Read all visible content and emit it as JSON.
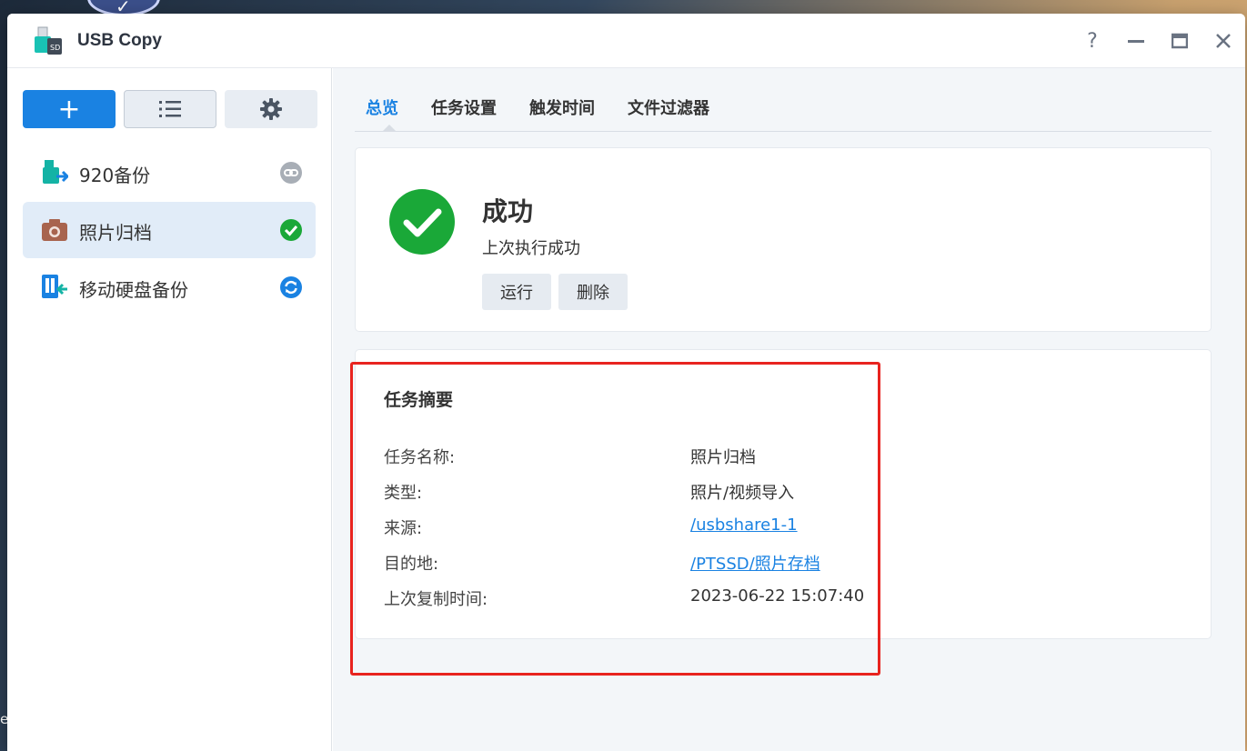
{
  "window": {
    "title": "USB Copy"
  },
  "window_controls": {
    "help": "?",
    "minimize": "—",
    "maximize": "□",
    "close": "✕"
  },
  "sidebar": {
    "toolbar": {
      "add_label": "+"
    },
    "tasks": [
      {
        "label": "920备份",
        "icon": "usb-export-icon",
        "status": "link-icon"
      },
      {
        "label": "照片归档",
        "icon": "camera-icon",
        "status": "success-check-icon"
      },
      {
        "label": "移动硬盘备份",
        "icon": "drive-sync-icon",
        "status": "sync-icon"
      }
    ]
  },
  "tabs": [
    "总览",
    "任务设置",
    "触发时间",
    "文件过滤器"
  ],
  "status_card": {
    "title": "成功",
    "subtitle": "上次执行成功",
    "run_label": "运行",
    "delete_label": "删除"
  },
  "summary": {
    "title": "任务摘要",
    "rows": [
      {
        "key": "任务名称:",
        "value": "照片归档",
        "link": false
      },
      {
        "key": "类型:",
        "value": "照片/视频导入",
        "link": false
      },
      {
        "key": "来源:",
        "value": "/usbshare1-1",
        "link": true
      },
      {
        "key": "目的地:",
        "value": "/PTSSD/照片存档",
        "link": true
      },
      {
        "key": "上次复制时间:",
        "value": "2023-06-22 15:07:40",
        "link": false
      }
    ]
  },
  "colors": {
    "accent": "#1a82e2",
    "success": "#1aa838",
    "highlight": "#e8231f"
  }
}
